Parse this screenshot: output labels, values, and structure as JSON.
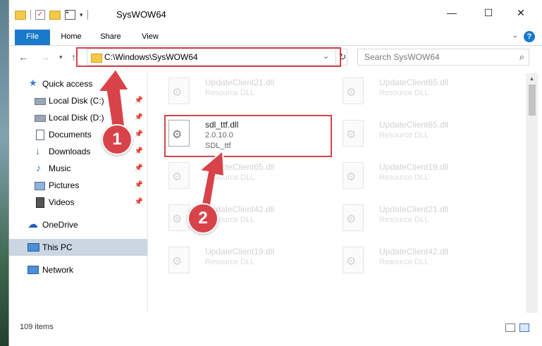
{
  "window": {
    "title": "SysWOW64",
    "controls": {
      "minimize": "—",
      "maximize": "☐",
      "close": "✕"
    }
  },
  "ribbon": {
    "tabs": [
      {
        "label": "File"
      },
      {
        "label": "Home"
      },
      {
        "label": "Share"
      },
      {
        "label": "View"
      }
    ],
    "expand_icon": "chevron-down-icon",
    "help_label": "?"
  },
  "navigation": {
    "address": "C:\\Windows\\SysWOW64",
    "search_placeholder": "Search SysWOW64"
  },
  "nav_pane": {
    "items": [
      {
        "label": "Quick access",
        "icon": "star-icon"
      },
      {
        "label": "Local Disk (C:)",
        "icon": "drive-icon",
        "pinned": true
      },
      {
        "label": "Local Disk (D:)",
        "icon": "drive-icon",
        "pinned": true
      },
      {
        "label": "Documents",
        "icon": "documents-icon",
        "pinned": true
      },
      {
        "label": "Downloads",
        "icon": "download-icon",
        "pinned": true
      },
      {
        "label": "Music",
        "icon": "music-icon",
        "pinned": true
      },
      {
        "label": "Pictures",
        "icon": "pictures-icon",
        "pinned": true
      },
      {
        "label": "Videos",
        "icon": "videos-icon",
        "pinned": true
      },
      {
        "label": "OneDrive",
        "icon": "cloud-icon"
      },
      {
        "label": "This PC",
        "icon": "computer-icon",
        "selected": true
      },
      {
        "label": "Network",
        "icon": "network-icon"
      }
    ]
  },
  "files": {
    "left": [
      {
        "name": "UpdateClient21.dll",
        "desc": "Resource DLL"
      },
      {
        "name": "sdl_ttf.dll",
        "version": "2.0.10.0",
        "desc": "SDL_ttf",
        "active": true
      },
      {
        "name": "UpdateClient65.dll",
        "desc": "Resource DLL"
      },
      {
        "name": "UpdateClient42.dll",
        "desc": "Resource DLL"
      },
      {
        "name": "UpdateClient19.dll",
        "desc": "Resource DLL"
      }
    ],
    "right": [
      {
        "name": "UpdateClient65.dll",
        "desc": "Resource DLL"
      },
      {
        "name": "UpdateClient65.dll",
        "desc": "Resource DLL"
      },
      {
        "name": "UpdateClient19.dll",
        "desc": "Resource DLL"
      },
      {
        "name": "UpdateClient21.dll",
        "desc": "Resource DLL"
      },
      {
        "name": "UpdateClient42.dll",
        "desc": "Resource DLL"
      }
    ]
  },
  "status": {
    "item_count": "109 items"
  },
  "annotations": [
    {
      "number": "1"
    },
    {
      "number": "2"
    }
  ],
  "colors": {
    "accent": "#1979ca",
    "highlight": "#d8434a",
    "selected_bg": "#ccd6e3"
  }
}
